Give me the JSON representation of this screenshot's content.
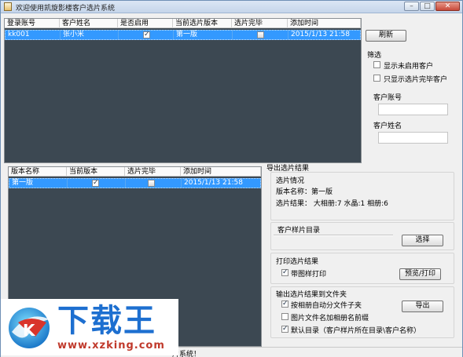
{
  "window": {
    "title": "欢迎使用凯旋影楼客户选片系统"
  },
  "customer_grid": {
    "columns": [
      "登录账号",
      "客户姓名",
      "是否启用",
      "当前选片版本",
      "选片完毕",
      "添加时间"
    ],
    "rows": [
      {
        "account": "kk001",
        "name": "张小米",
        "enabled": true,
        "version": "第一版",
        "done": false,
        "time": "2015/1/13 21:58"
      }
    ]
  },
  "refresh_button": "刷新",
  "filter": {
    "title": "筛选",
    "show_disabled": "显示未启用客户",
    "show_done_only": "只显示选片完毕客户",
    "account_label": "客户账号",
    "account_value": "",
    "name_label": "客户姓名",
    "name_value": ""
  },
  "version_grid": {
    "columns": [
      "版本名称",
      "当前版本",
      "选片完毕",
      "添加时间"
    ],
    "rows": [
      {
        "version": "第一版",
        "current": true,
        "done": false,
        "time": "2015/1/13 21:58"
      }
    ]
  },
  "export": {
    "title": "导出选片结果",
    "status_title": "选片情况",
    "version_line": "版本名称：第一版",
    "result_line": "选片结果：  大相册:7 水晶:1 相册:6",
    "sample_dir_title": "客户样片目录",
    "sample_dir_value": "",
    "choose_button": "选择",
    "print_title": "打印选片结果",
    "print_with_image": "带图样打印",
    "preview_print_button": "预览/打印",
    "to_folder_title": "输出选片结果到文件夹",
    "opt_split_by_album": "按相册自动分文件子夹",
    "opt_prefix_album_name": "图片文件名加相册名前缀",
    "opt_default_dir": "默认目录（客户样片所在目录\\客户名称）",
    "export_button": "导出"
  },
  "status_bar": {
    "text": "片系统！"
  },
  "watermark": {
    "brand_cn": "下载王",
    "url": "www.xzking.com"
  }
}
